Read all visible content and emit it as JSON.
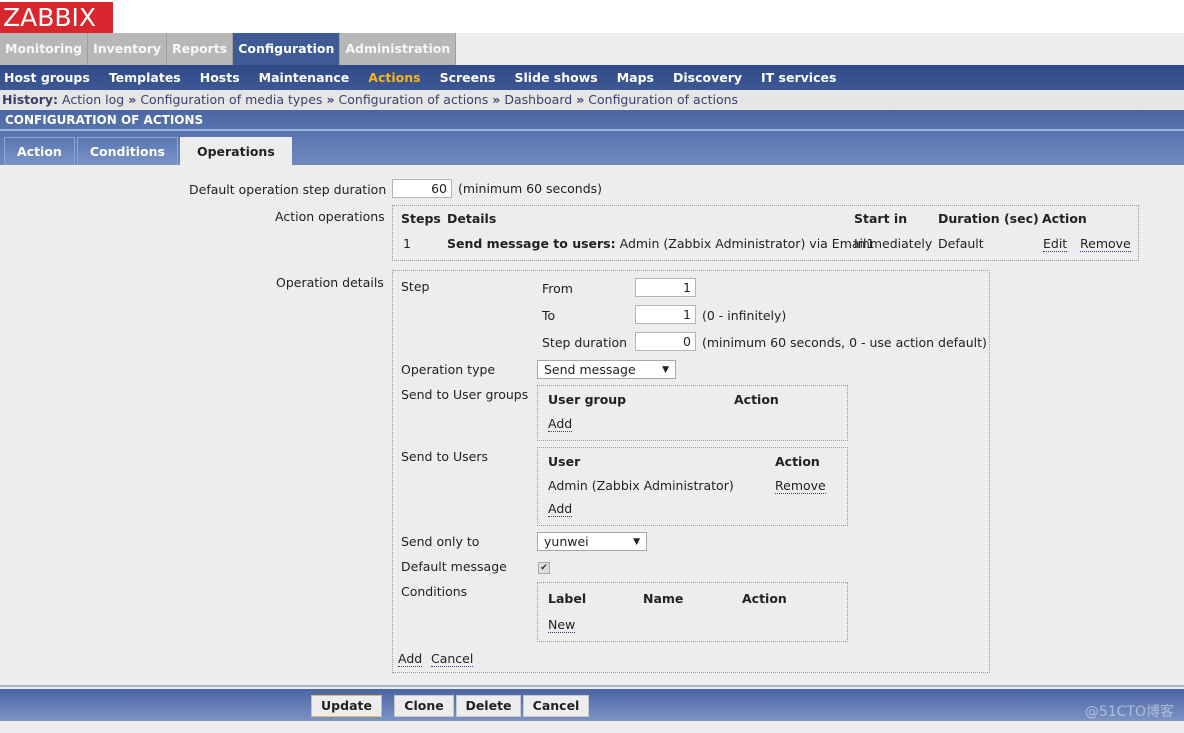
{
  "logo": "ZABBIX",
  "main_menu": [
    {
      "label": "Monitoring",
      "active": false
    },
    {
      "label": "Inventory",
      "active": false
    },
    {
      "label": "Reports",
      "active": false
    },
    {
      "label": "Configuration",
      "active": true
    },
    {
      "label": "Administration",
      "active": false
    }
  ],
  "sub_menu": [
    {
      "label": "Host groups",
      "active": false
    },
    {
      "label": "Templates",
      "active": false
    },
    {
      "label": "Hosts",
      "active": false
    },
    {
      "label": "Maintenance",
      "active": false
    },
    {
      "label": "Actions",
      "active": true
    },
    {
      "label": "Screens",
      "active": false
    },
    {
      "label": "Slide shows",
      "active": false
    },
    {
      "label": "Maps",
      "active": false
    },
    {
      "label": "Discovery",
      "active": false
    },
    {
      "label": "IT services",
      "active": false
    }
  ],
  "history": {
    "label": "History:",
    "separator": "»",
    "items": [
      "Action log",
      "Configuration of media types",
      "Configuration of actions",
      "Dashboard",
      "Configuration of actions"
    ]
  },
  "page_title": "CONFIGURATION OF ACTIONS",
  "tabs": [
    {
      "label": "Action",
      "active": false
    },
    {
      "label": "Conditions",
      "active": false
    },
    {
      "label": "Operations",
      "active": true
    }
  ],
  "form": {
    "default_step_duration": {
      "label": "Default operation step duration",
      "value": "60",
      "hint": "(minimum 60 seconds)"
    },
    "action_operations": {
      "label": "Action operations",
      "columns": [
        "Steps",
        "Details",
        "Start in",
        "Duration (sec)",
        "Action"
      ],
      "rows": [
        {
          "steps": "1",
          "details_bold": "Send message to users:",
          "details": "Admin (Zabbix Administrator) via Email1",
          "start_in": "Immediately",
          "duration": "Default",
          "edit": "Edit",
          "remove": "Remove"
        }
      ]
    },
    "operation_details": {
      "label": "Operation details",
      "step": {
        "label": "Step",
        "from_label": "From",
        "from_value": "1",
        "to_label": "To",
        "to_value": "1",
        "to_hint": "(0 - infinitely)",
        "duration_label": "Step duration",
        "duration_value": "0",
        "duration_hint": "(minimum 60 seconds, 0 - use action default)"
      },
      "operation_type": {
        "label": "Operation type",
        "value": "Send message"
      },
      "user_groups": {
        "label": "Send to User groups",
        "columns": [
          "User group",
          "Action"
        ],
        "add": "Add"
      },
      "users": {
        "label": "Send to Users",
        "columns": [
          "User",
          "Action"
        ],
        "rows": [
          {
            "user": "Admin (Zabbix Administrator)",
            "remove": "Remove"
          }
        ],
        "add": "Add"
      },
      "send_only_to": {
        "label": "Send only to",
        "value": "yunwei"
      },
      "default_message": {
        "label": "Default message",
        "checked": true
      },
      "conditions": {
        "label": "Conditions",
        "columns": [
          "Label",
          "Name",
          "Action"
        ],
        "new": "New"
      },
      "add": "Add",
      "cancel": "Cancel"
    }
  },
  "footer": {
    "update": "Update",
    "clone": "Clone",
    "delete": "Delete",
    "cancel": "Cancel",
    "watermark": "@51CTO博客"
  }
}
